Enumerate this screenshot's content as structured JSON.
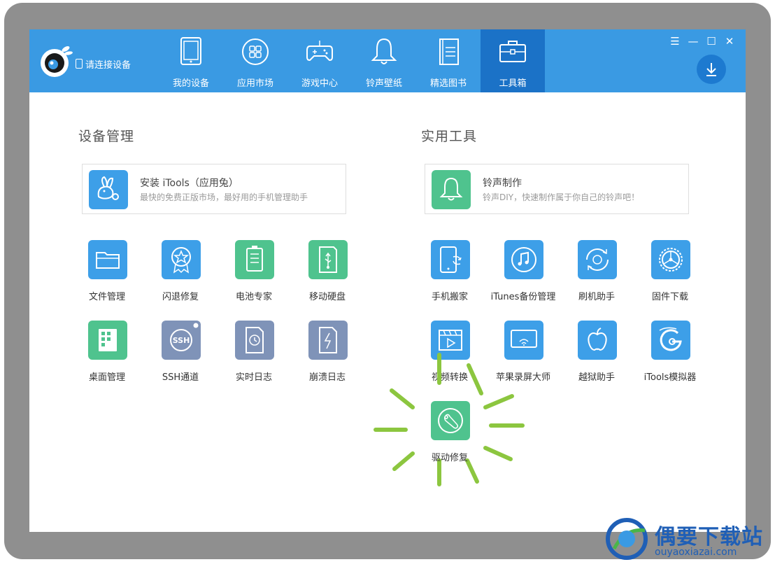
{
  "header": {
    "connect_text": "请连接设备",
    "tabs": [
      {
        "label": "我的设备",
        "icon": "tablet-icon",
        "active": false
      },
      {
        "label": "应用市场",
        "icon": "apps-icon",
        "active": false
      },
      {
        "label": "游戏中心",
        "icon": "gamepad-icon",
        "active": false
      },
      {
        "label": "铃声壁纸",
        "icon": "bell-icon",
        "active": false
      },
      {
        "label": "精选图书",
        "icon": "book-icon",
        "active": false
      },
      {
        "label": "工具箱",
        "icon": "toolbox-icon",
        "active": true
      }
    ],
    "window_controls": [
      "menu-icon",
      "minimize-icon",
      "maximize-icon",
      "close-icon"
    ],
    "download_icon": "download-icon",
    "accent_color": "#3a9ae3",
    "active_tab_color": "#1b72c7"
  },
  "device_management": {
    "title": "设备管理",
    "featured": {
      "title": "安装 iTools（应用兔）",
      "subtitle": "最快的免费正版市场，最好用的手机管理助手",
      "icon": "rabbit-icon"
    },
    "tools": [
      {
        "label": "文件管理",
        "icon": "folder-icon",
        "color": "blue"
      },
      {
        "label": "闪退修复",
        "icon": "star-badge-icon",
        "color": "blue"
      },
      {
        "label": "电池专家",
        "icon": "battery-icon",
        "color": "green"
      },
      {
        "label": "移动硬盘",
        "icon": "usb-drive-icon",
        "color": "green"
      },
      {
        "label": "桌面管理",
        "icon": "grid-icon",
        "color": "green"
      },
      {
        "label": "SSH通道",
        "icon": "ssh-icon",
        "color": "slate"
      },
      {
        "label": "实时日志",
        "icon": "clock-log-icon",
        "color": "slate"
      },
      {
        "label": "崩溃日志",
        "icon": "lightning-log-icon",
        "color": "slate"
      }
    ]
  },
  "utilities": {
    "title": "实用工具",
    "featured": {
      "title": "铃声制作",
      "subtitle": "铃声DIY，快速制作属于你自己的铃声吧！",
      "icon": "bell-icon"
    },
    "tools": [
      {
        "label": "手机搬家",
        "icon": "phone-transfer-icon",
        "color": "blue"
      },
      {
        "label": "iTunes备份管理",
        "icon": "music-note-icon",
        "color": "blue"
      },
      {
        "label": "刷机助手",
        "icon": "refresh-gear-icon",
        "color": "blue"
      },
      {
        "label": "固件下载",
        "icon": "wheel-icon",
        "color": "blue"
      },
      {
        "label": "视频转换",
        "icon": "film-icon",
        "color": "blue"
      },
      {
        "label": "苹果录屏大师",
        "icon": "airplay-icon",
        "color": "blue"
      },
      {
        "label": "越狱助手",
        "icon": "apple-icon",
        "color": "blue"
      },
      {
        "label": "iTools模拟器",
        "icon": "g-logo-icon",
        "color": "blue"
      },
      {
        "label": "驱动修复",
        "icon": "wrench-icon",
        "color": "green"
      }
    ]
  },
  "watermark": {
    "title": "偶要下载站",
    "url": "ouyaoxiazai.com"
  }
}
